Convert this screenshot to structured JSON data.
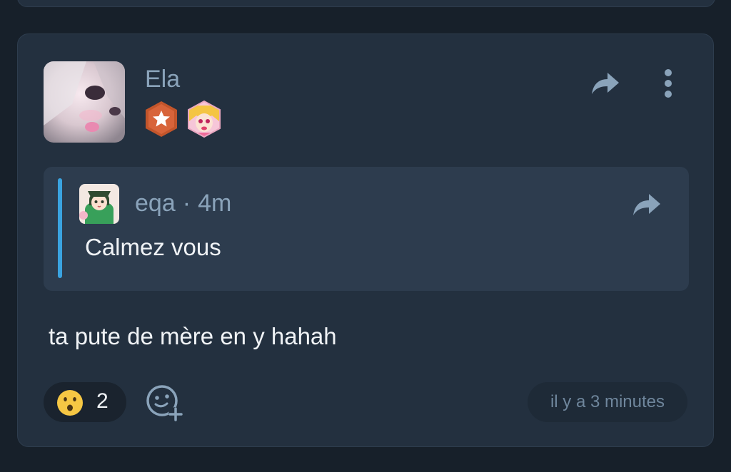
{
  "post": {
    "author": "Ela",
    "message": "ta pute de mère en y hahah",
    "timestamp": "il y a 3 minutes",
    "badges": [
      "star-badge-icon",
      "anime-avatar-badge-icon"
    ]
  },
  "quote": {
    "author": "eqa",
    "separator": "·",
    "age": "4m",
    "text": "Calmez vous"
  },
  "reaction": {
    "emoji": "hushed-face-icon",
    "count": "2"
  },
  "colors": {
    "background": "#17202a",
    "card": "#23303f",
    "quote": "#2d3c4e",
    "accent": "#3aa3e0",
    "muted_text": "#8aa3ba",
    "text": "#f0f3f6"
  }
}
